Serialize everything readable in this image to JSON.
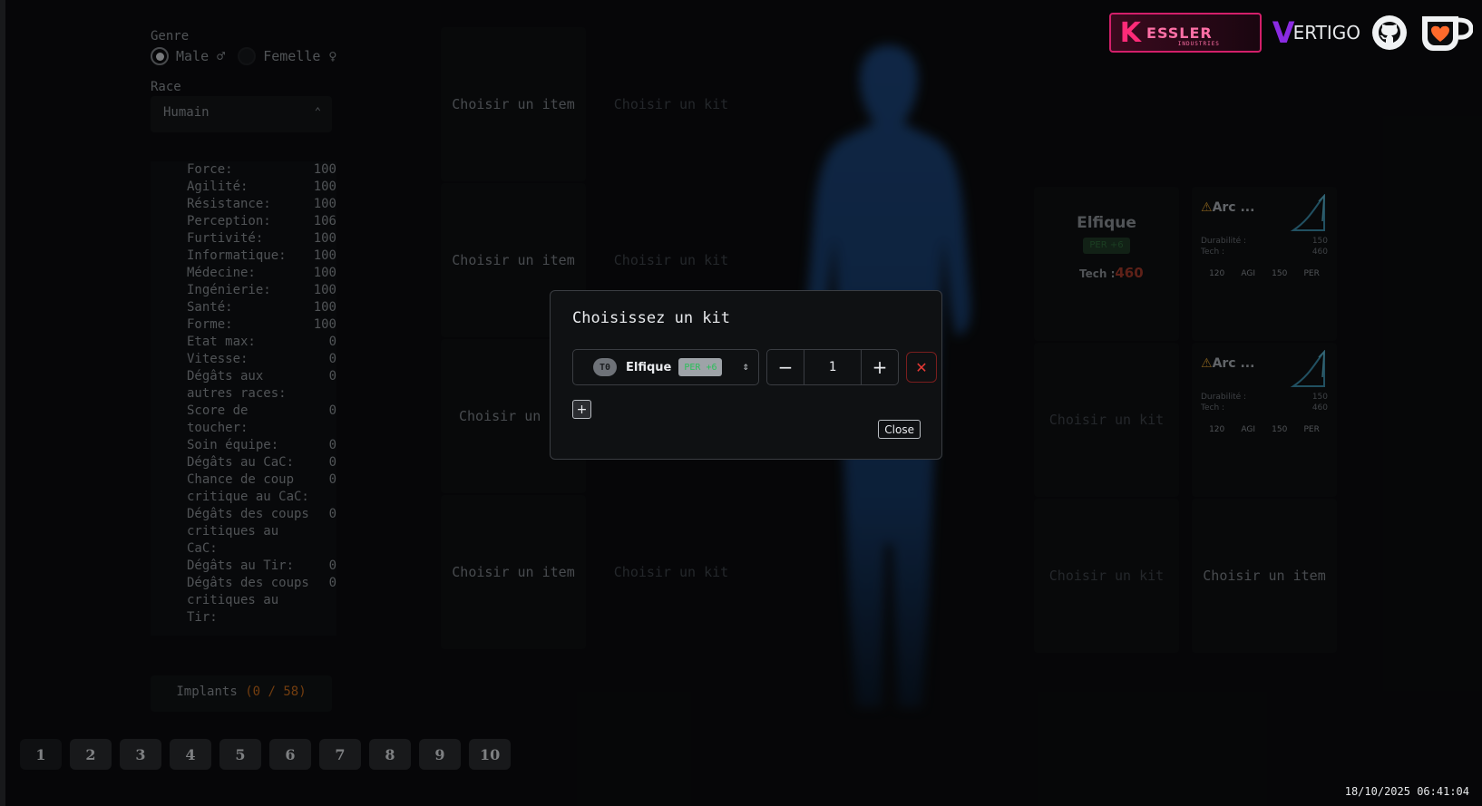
{
  "left": {
    "genre_label": "Genre",
    "gender_options": [
      "Male ♂",
      "Femelle ♀"
    ],
    "race_label": "Race",
    "race_value": "Humain",
    "stats": [
      {
        "label": "Force:",
        "value": "100"
      },
      {
        "label": "Agilité:",
        "value": "100"
      },
      {
        "label": "Résistance:",
        "value": "100"
      },
      {
        "label": "Perception:",
        "value": "106"
      },
      {
        "label": "Furtivité:",
        "value": "100"
      },
      {
        "label": "Informatique:",
        "value": "100"
      },
      {
        "label": "Médecine:",
        "value": "100"
      },
      {
        "label": "Ingénierie:",
        "value": "100"
      },
      {
        "label": "Santé:",
        "value": "100"
      },
      {
        "label": "Forme:",
        "value": "100"
      },
      {
        "label": "Etat max:",
        "value": "0"
      },
      {
        "label": "Vitesse:",
        "value": "0"
      },
      {
        "label": "Dégâts aux autres races:",
        "value": "0"
      },
      {
        "label": "Score de toucher:",
        "value": "0"
      },
      {
        "label": "Soin équipe:",
        "value": "0"
      },
      {
        "label": "Dégâts au CaC:",
        "value": "0"
      },
      {
        "label": "Chance de coup critique au CaC:",
        "value": "0"
      },
      {
        "label": "Dégâts des coups critiques au CaC:",
        "value": "0"
      },
      {
        "label": "Dégâts au Tir:",
        "value": "0"
      },
      {
        "label": "Dégâts des coups critiques au Tir:",
        "value": "0"
      }
    ],
    "implants_label": "Implants",
    "implants_count": "(0 / 58)"
  },
  "tiles": {
    "choose_item": "Choisir un item",
    "choose_kit": "Choisir un kit",
    "choose_item_partial": "Choisir un"
  },
  "equipped_kit": {
    "name": "Elfique",
    "badge": "PER +6",
    "tech_label": "Tech :",
    "tech_value": "460"
  },
  "arc_cards": [
    {
      "name": "Arc ...",
      "durability_label": "Durabilité :",
      "durability": "150",
      "tech_label": "Tech :",
      "tech": "460",
      "req": [
        "120",
        "AGI",
        "150",
        "PER"
      ]
    },
    {
      "name": "Arc ...",
      "durability_label": "Durabilité :",
      "durability": "150",
      "tech_label": "Tech :",
      "tech": "460",
      "req": [
        "120",
        "AGI",
        "150",
        "PER"
      ]
    }
  ],
  "pager": [
    "1",
    "2",
    "3",
    "4",
    "5",
    "6",
    "7",
    "8",
    "9",
    "10"
  ],
  "datetime": "18/10/2025 06:41:04",
  "header": {
    "kessler_text": "ESSLER",
    "kessler_k": "K",
    "kessler_sub": "INDUSTRIES",
    "vertigo_v": "V",
    "vertigo_text": "ERTIGO"
  },
  "modal": {
    "title": "Choisissez un kit",
    "tier": "T0",
    "kit_name": "Elfique",
    "kit_bonus": "PER +6",
    "quantity": "1",
    "minus": "−",
    "plus": "+",
    "remove": "✕",
    "add": "+",
    "close": "Close"
  },
  "colors": {
    "accent_red": "#e53935",
    "kessler_pink": "#ff2b78",
    "vertigo_purple": "#8a2be2",
    "implant_orange": "#c56a1a"
  }
}
